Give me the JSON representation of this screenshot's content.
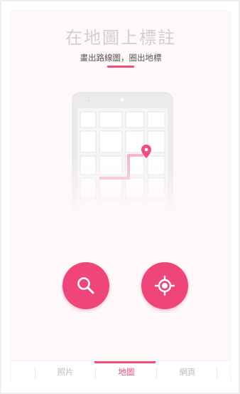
{
  "header": {
    "title": "在地圖上標註",
    "subtitle": "畫出路線圖，圈出地標"
  },
  "actions": {
    "search_icon": "search-icon",
    "locate_icon": "crosshair-icon"
  },
  "tabs": [
    {
      "label": "照片",
      "active": false
    },
    {
      "label": "地圖",
      "active": true
    },
    {
      "label": "網頁",
      "active": false
    }
  ],
  "colors": {
    "accent": "#f04e7c",
    "background": "#fff8f8",
    "title_text": "#d0d0d0",
    "subtitle_text": "#555555",
    "tab_inactive": "#bdbdbd"
  }
}
